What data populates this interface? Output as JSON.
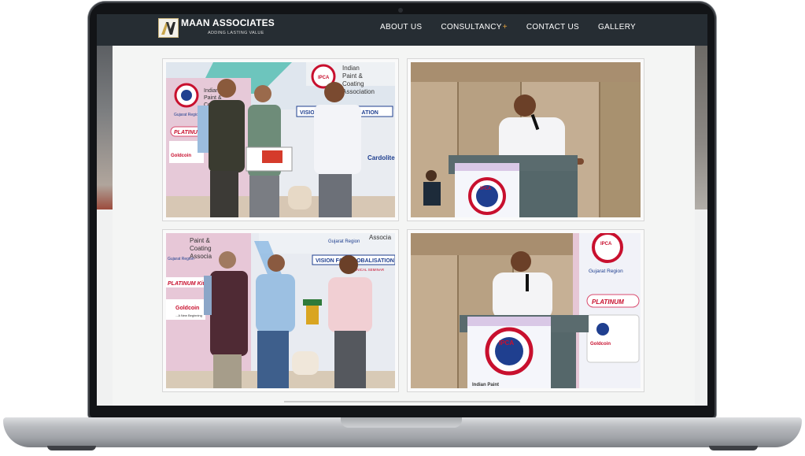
{
  "brand": {
    "name": "MAAN ASSOCIATES",
    "tagline": "ADDING LASTING VALUE",
    "logo_letter": "M"
  },
  "nav": {
    "items": [
      "ABOUT US",
      "CONSULTANCY",
      "CONTACT US",
      "GALLERY"
    ],
    "consultancy_marker": "+"
  },
  "colors": {
    "navbar": "#262d33",
    "accent": "#e2a03b",
    "banner_red": "#c8102e",
    "banner_blue": "#1f3f8f"
  },
  "gallery": {
    "photos": [
      {
        "scene": "award-presentation",
        "banner_texts": [
          "Indian",
          "Paint &",
          "Coating",
          "Association",
          "VISION FOR GLOBALISATION",
          "Gujarat Region",
          "PLATINUM",
          "Goldcoin",
          "Cardolite",
          "IPCA"
        ]
      },
      {
        "scene": "speaker-at-podium",
        "banner_texts": [
          "IPCA"
        ]
      },
      {
        "scene": "memento-presentation",
        "banner_texts": [
          "Paint &",
          "Coating",
          "Associa",
          "Gujarat Region",
          "Associa",
          "VISION FOR GLOBALISATION",
          "TECHNICAL SEMINAR",
          "PLATINUM Kit S",
          "Goldcoin",
          "...A New Beginning"
        ]
      },
      {
        "scene": "speaker-at-podium-with-banner",
        "banner_texts": [
          "IPCA",
          "Gujarat Region",
          "PLATINUM",
          "Goldcoin",
          "Indian Paint"
        ]
      }
    ]
  }
}
